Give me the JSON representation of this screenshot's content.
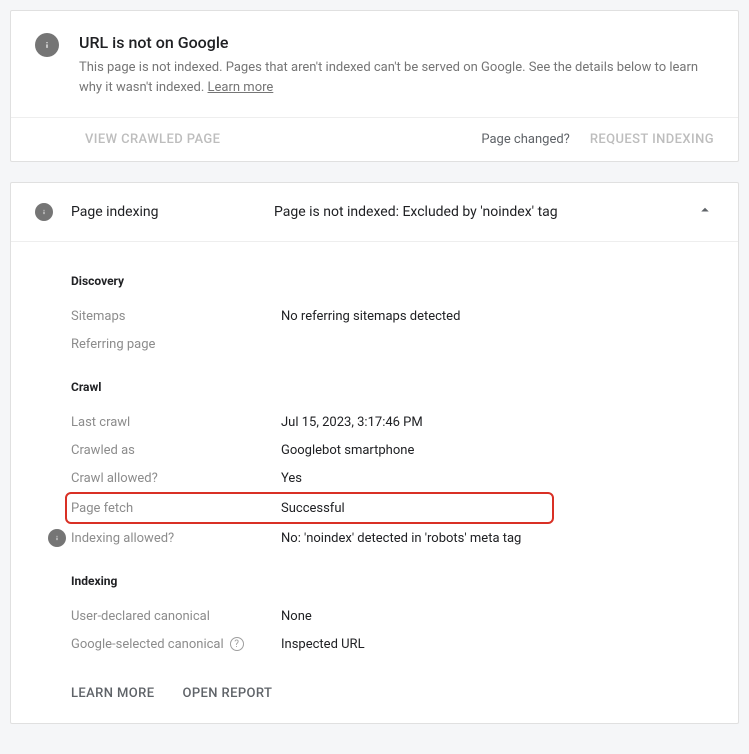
{
  "notice": {
    "title": "URL is not on Google",
    "desc": "This page is not indexed. Pages that aren't indexed can't be served on Google. See the details below to learn why it wasn't indexed. ",
    "learn": "Learn more",
    "view_crawled": "View crawled page",
    "page_changed": "Page changed?",
    "request_indexing": "Request indexing"
  },
  "indexing_panel": {
    "label": "Page indexing",
    "status": "Page is not indexed: Excluded by 'noindex' tag"
  },
  "groups": {
    "discovery": {
      "title": "Discovery",
      "sitemaps_label": "Sitemaps",
      "sitemaps_value": "No referring sitemaps detected",
      "referring_label": "Referring page",
      "referring_value": ""
    },
    "crawl": {
      "title": "Crawl",
      "last_crawl_label": "Last crawl",
      "last_crawl_value": "Jul 15, 2023, 3:17:46 PM",
      "crawled_as_label": "Crawled as",
      "crawled_as_value": "Googlebot smartphone",
      "crawl_allowed_label": "Crawl allowed?",
      "crawl_allowed_value": "Yes",
      "page_fetch_label": "Page fetch",
      "page_fetch_value": "Successful",
      "indexing_allowed_label": "Indexing allowed?",
      "indexing_allowed_value": "No: 'noindex' detected in 'robots' meta tag"
    },
    "indexing": {
      "title": "Indexing",
      "user_canonical_label": "User-declared canonical",
      "user_canonical_value": "None",
      "google_canonical_label": "Google-selected canonical",
      "google_canonical_value": "Inspected URL"
    }
  },
  "footer": {
    "learn_more": "Learn more",
    "open_report": "Open report"
  }
}
